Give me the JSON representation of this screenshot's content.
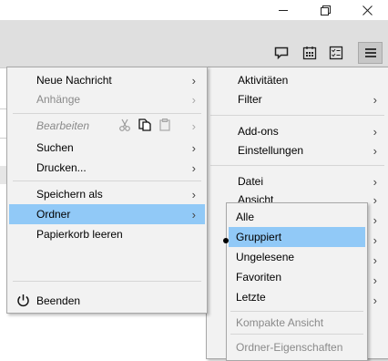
{
  "window": {
    "controls": {
      "minimize": "minimize-icon",
      "maximize": "restore-icon",
      "close": "close-icon"
    }
  },
  "toolbar": {
    "icons": [
      "chat-icon",
      "calendar-icon",
      "tasks-icon",
      "hamburger-menu-icon"
    ]
  },
  "main_menu": {
    "items": [
      {
        "label": "Neue Nachricht",
        "has_submenu": true
      },
      {
        "label": "Anhänge",
        "disabled": true,
        "has_submenu": true
      },
      {
        "label": "Bearbeiten",
        "disabled": true,
        "has_submenu": true,
        "icons": [
          "cut-icon",
          "copy-icon",
          "paste-icon"
        ]
      },
      {
        "label": "Suchen",
        "has_submenu": true
      },
      {
        "label": "Drucken...",
        "has_submenu": true
      },
      {
        "label": "Speichern als",
        "has_submenu": true
      },
      {
        "label": "Ordner",
        "has_submenu": true,
        "highlighted": true
      },
      {
        "label": "Papierkorb leeren"
      },
      {
        "label": "Beenden",
        "icon": "power-icon"
      }
    ]
  },
  "right_menu": {
    "items": [
      {
        "label": "Aktivitäten"
      },
      {
        "label": "Filter",
        "has_submenu": true
      },
      {
        "label": "Add-ons",
        "has_submenu": true
      },
      {
        "label": "Einstellungen",
        "has_submenu": true
      },
      {
        "label": "Datei",
        "has_submenu": true
      },
      {
        "label": "Ansicht",
        "has_submenu": true
      }
    ]
  },
  "folder_submenu": {
    "items": [
      {
        "label": "Alle"
      },
      {
        "label": "Gruppiert",
        "selected": true
      },
      {
        "label": "Ungelesene"
      },
      {
        "label": "Favoriten"
      },
      {
        "label": "Letzte"
      },
      {
        "label": "Kompakte Ansicht",
        "disabled": true
      },
      {
        "label": "Ordner-Eigenschaften",
        "disabled": true
      }
    ]
  },
  "colors": {
    "highlight": "#91c9f7",
    "menu_bg": "#f2f2f2",
    "toolbar_bg": "#dfdfdf"
  }
}
